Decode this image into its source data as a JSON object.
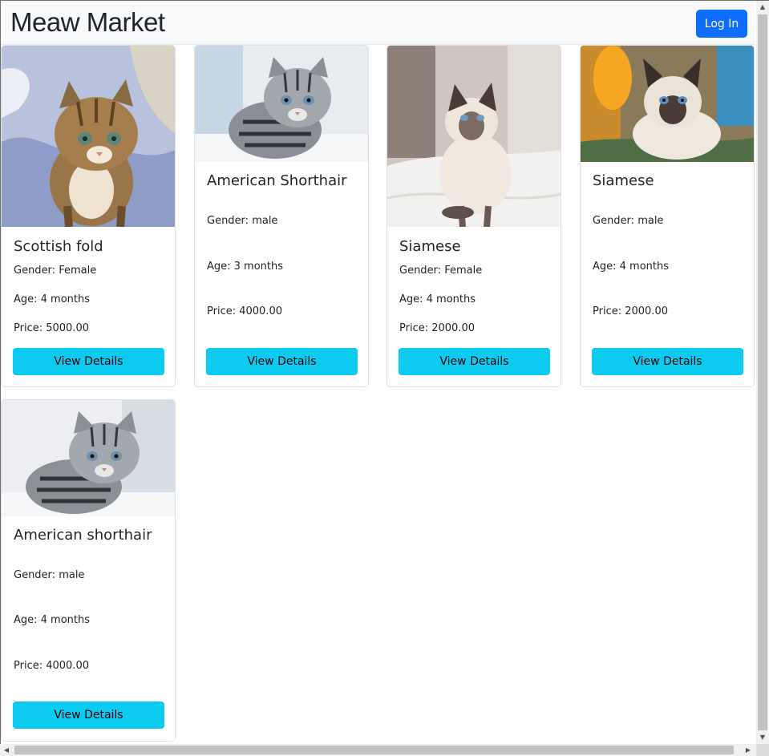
{
  "header": {
    "brand": "Meaw Market",
    "login_label": "Log In"
  },
  "cards": [
    {
      "name": "Scottish fold",
      "gender": "Gender: Female",
      "age": "Age: 4 months",
      "price": "Price: 5000.00",
      "button": "View Details",
      "photo": "tabby-kitten-on-blanket"
    },
    {
      "name": "American Shorthair",
      "gender": "Gender: male",
      "age": "Age: 3 months",
      "price": "Price: 4000.00",
      "button": "View Details",
      "photo": "silver-tabby-kitten"
    },
    {
      "name": "Siamese",
      "gender": "Gender: Female",
      "age": "Age: 4 months",
      "price": "Price: 2000.00",
      "button": "View Details",
      "photo": "siamese-kitten-on-bed"
    },
    {
      "name": "Siamese",
      "gender": "Gender: male",
      "age": "Age: 4 months",
      "price": "Price: 2000.00",
      "button": "View Details",
      "photo": "siamese-kitten-colorful-background"
    },
    {
      "name": "American shorthair",
      "gender": "Gender: male",
      "age": "Age: 4 months",
      "price": "Price: 4000.00",
      "button": "View Details",
      "photo": "silver-tabby-kitten"
    }
  ],
  "colors": {
    "primary": "#0d6efd",
    "info": "#0dcaf0",
    "navbar_bg": "#f8f9fa"
  }
}
